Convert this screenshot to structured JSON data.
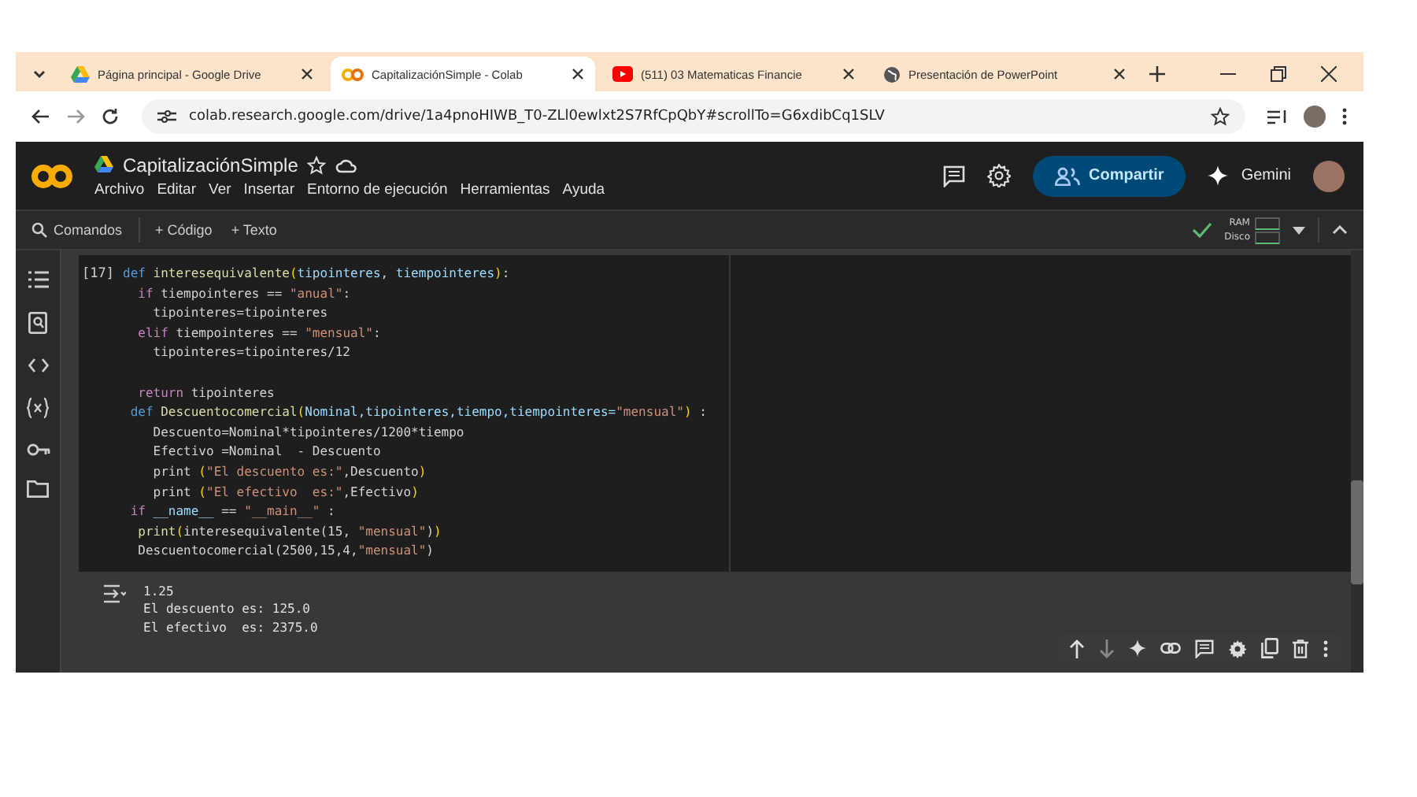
{
  "browser": {
    "tabs": [
      {
        "title": "Página principal - Google Drive",
        "kind": "drive",
        "selected": false
      },
      {
        "title": "CapitalizaciónSimple - Colab",
        "kind": "colab",
        "selected": true
      },
      {
        "title": "(511) 03 Matematicas Financie",
        "kind": "video",
        "selected": false
      },
      {
        "title": "Presentación de PowerPoint",
        "kind": "web",
        "selected": false
      }
    ],
    "url": "colab.research.google.com/drive/1a4pnoHIWB_T0-ZLl0ewlxt2S7RfCpQbY#scrollTo=G6xdibCq1SLV"
  },
  "notebook": {
    "title": "CapitalizaciónSimple",
    "menu": [
      "Archivo",
      "Editar",
      "Ver",
      "Insertar",
      "Entorno de ejecución",
      "Herramientas",
      "Ayuda"
    ],
    "share": "Compartir",
    "gemini": "Gemini",
    "toolbar": {
      "search": "Comandos",
      "add_code": "+ Código",
      "add_text": "+ Texto"
    },
    "resources": {
      "ram": "RAM",
      "disk": "Disco",
      "connected": true
    },
    "cell": {
      "count": "[17]",
      "lines": [
        {
          "tokens": [
            {
              "kind": "kw",
              "text": "def "
            },
            {
              "kind": "fn",
              "text": "interesequivalente"
            },
            {
              "kind": "paren",
              "text": "("
            },
            {
              "kind": "var",
              "text": "tipointeres"
            },
            {
              "kind": "plain",
              "text": ", "
            },
            {
              "kind": "var",
              "text": "tiempointeres"
            },
            {
              "kind": "paren",
              "text": ")"
            },
            {
              "kind": "plain",
              "text": ":"
            }
          ]
        },
        {
          "tokens": [
            {
              "kind": "ctl",
              "text": "  if "
            },
            {
              "kind": "plain",
              "text": "tiempointeres == "
            },
            {
              "kind": "str",
              "text": "\"anual\""
            },
            {
              "kind": "plain",
              "text": ":"
            }
          ]
        },
        {
          "tokens": [
            {
              "kind": "plain",
              "text": "    tipointeres=tipointeres"
            }
          ]
        },
        {
          "tokens": [
            {
              "kind": "ctl",
              "text": "  elif "
            },
            {
              "kind": "plain",
              "text": "tiempointeres == "
            },
            {
              "kind": "str",
              "text": "\"mensual\""
            },
            {
              "kind": "plain",
              "text": ":"
            }
          ]
        },
        {
          "tokens": [
            {
              "kind": "plain",
              "text": "    tipointeres=tipointeres/12"
            }
          ]
        },
        {
          "blank_before": true,
          "tokens": [
            {
              "kind": "ctl",
              "text": "  return "
            },
            {
              "kind": "plain",
              "text": "tipointeres"
            }
          ]
        },
        {
          "tokens": [
            {
              "kind": "kw",
              "text": " def "
            },
            {
              "kind": "fn",
              "text": "Descuentocomercial"
            },
            {
              "kind": "paren",
              "text": "("
            },
            {
              "kind": "var",
              "text": "Nominal,tipointeres,tiempo,tiempointeres="
            },
            {
              "kind": "str",
              "text": "\"mensual\""
            },
            {
              "kind": "paren",
              "text": ")"
            },
            {
              "kind": "plain",
              "text": " :"
            }
          ]
        },
        {
          "tokens": [
            {
              "kind": "plain",
              "text": "    Descuento=Nominal*tipointeres/1200*tiempo"
            }
          ]
        },
        {
          "tokens": [
            {
              "kind": "plain",
              "text": "    Efectivo =Nominal  - Descuento"
            }
          ]
        },
        {
          "tokens": [
            {
              "kind": "plain",
              "text": "    print "
            },
            {
              "kind": "paren",
              "text": "("
            },
            {
              "kind": "str",
              "text": "\"El descuento es:\""
            },
            {
              "kind": "plain",
              "text": ",Descuento"
            },
            {
              "kind": "paren",
              "text": ")"
            }
          ]
        },
        {
          "tokens": [
            {
              "kind": "plain",
              "text": "    print "
            },
            {
              "kind": "paren",
              "text": "("
            },
            {
              "kind": "str",
              "text": "\"El efectivo  es:\""
            },
            {
              "kind": "plain",
              "text": ",Efectivo"
            },
            {
              "kind": "paren",
              "text": ")"
            }
          ]
        },
        {
          "tokens": [
            {
              "kind": "ctl",
              "text": " if "
            },
            {
              "kind": "var",
              "text": "__name__"
            },
            {
              "kind": "plain",
              "text": " == "
            },
            {
              "kind": "str",
              "text": "\"__main__\""
            },
            {
              "kind": "plain",
              "text": " :"
            }
          ]
        },
        {
          "tokens": [
            {
              "kind": "fn",
              "text": "  print"
            },
            {
              "kind": "paren",
              "text": "("
            },
            {
              "kind": "plain",
              "text": "interesequivalente(15, "
            },
            {
              "kind": "str",
              "text": "\"mensual\""
            },
            {
              "kind": "plain",
              "text": ")"
            },
            {
              "kind": "paren",
              "text": ")"
            }
          ]
        },
        {
          "tokens": [
            {
              "kind": "plain",
              "text": "  Descuentocomercial(2500,15,4,"
            },
            {
              "kind": "str",
              "text": "\"mensual\""
            },
            {
              "kind": "plain",
              "text": ")"
            }
          ]
        }
      ],
      "output": [
        "1.25",
        "El descuento es: 125.0",
        "El efectivo  es: 2375.0"
      ]
    }
  }
}
